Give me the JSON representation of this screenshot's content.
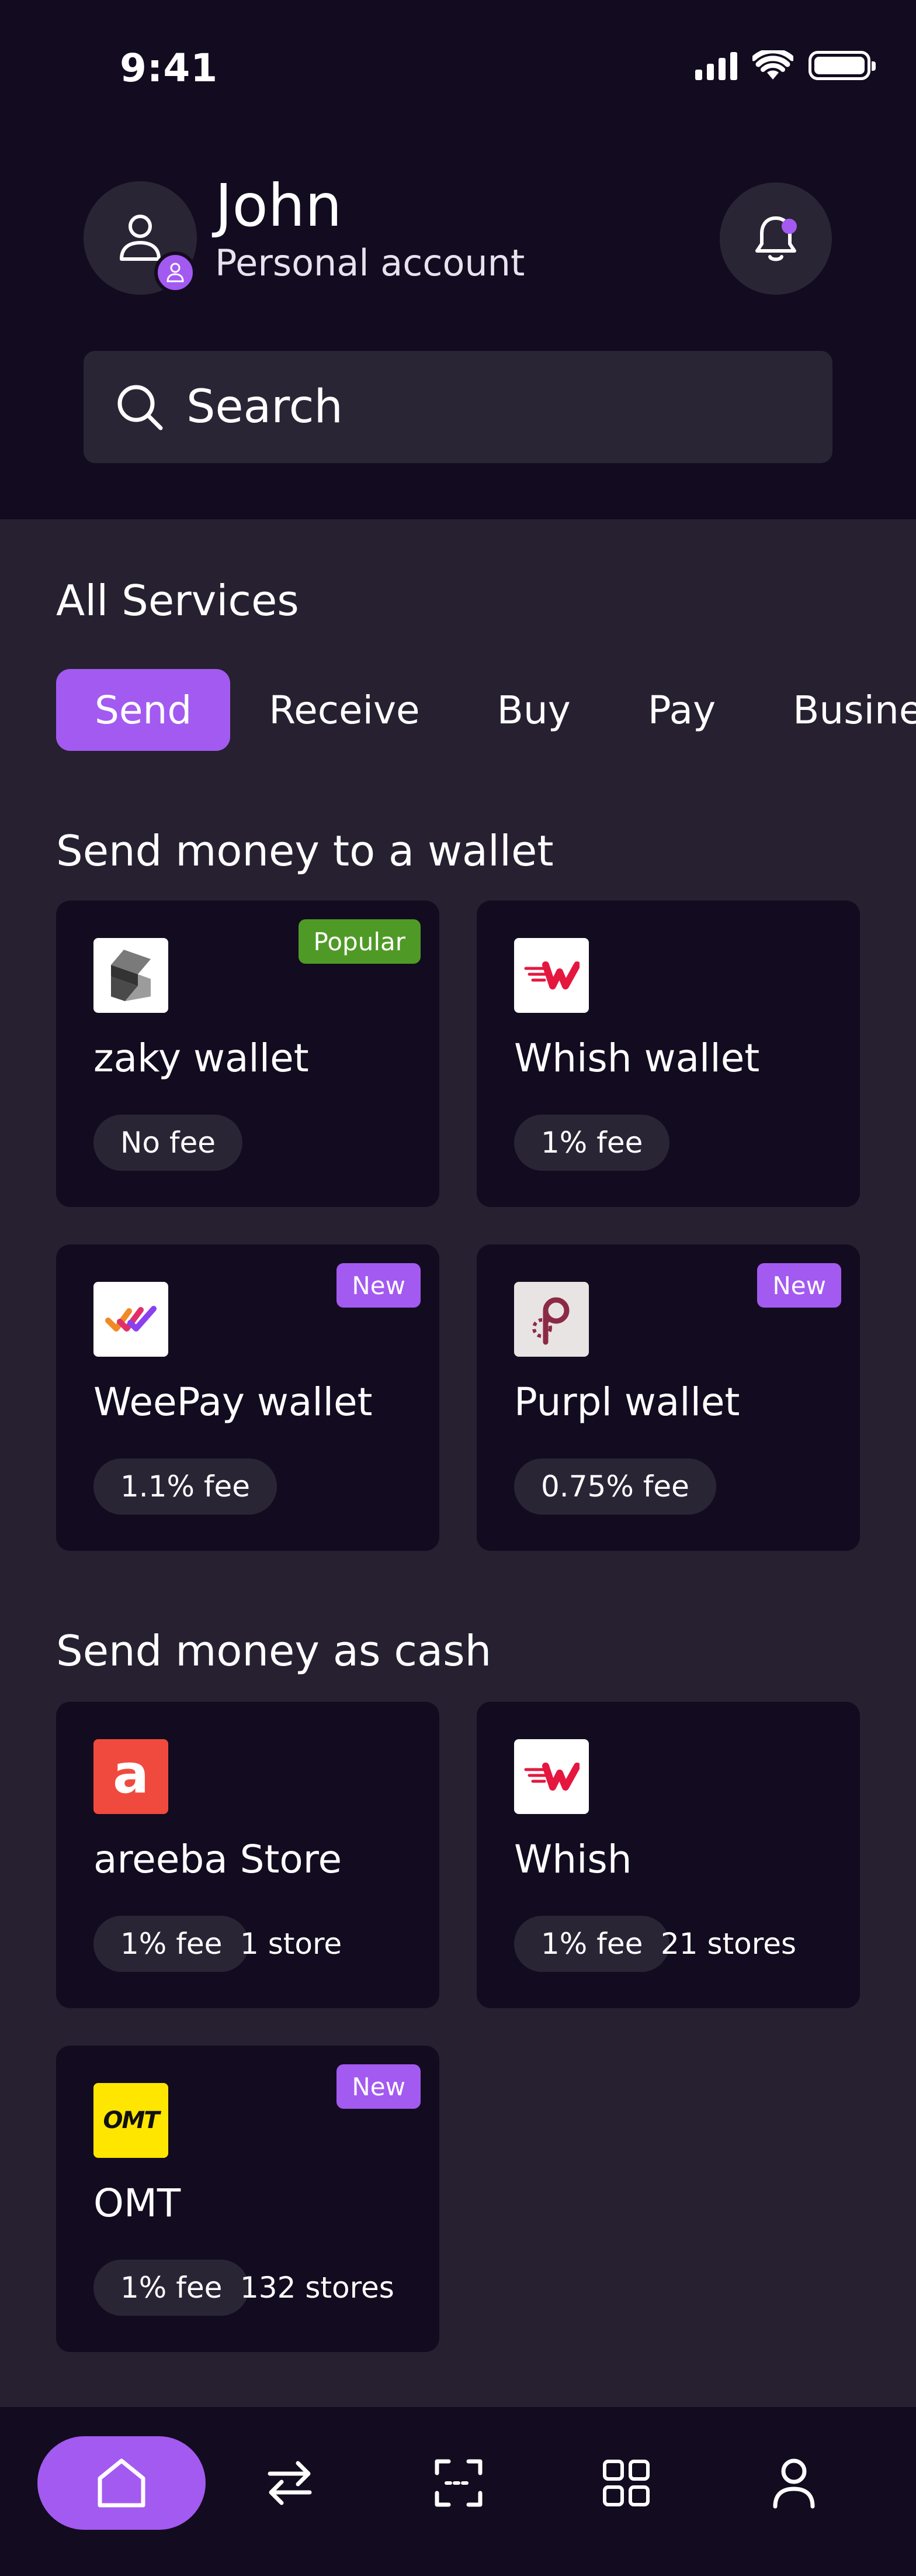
{
  "status_bar": {
    "time": "9:41"
  },
  "header": {
    "user_name": "John",
    "account_type": "Personal account"
  },
  "search": {
    "label": "Search"
  },
  "services": {
    "title": "All Services",
    "tabs": [
      {
        "label": "Send",
        "active": true
      },
      {
        "label": "Receive"
      },
      {
        "label": "Buy"
      },
      {
        "label": "Pay"
      },
      {
        "label": "Business"
      }
    ]
  },
  "wallet_section": {
    "title": "Send money to a wallet",
    "cards": [
      {
        "name": "zaky wallet",
        "fee": "No fee",
        "badge": "Popular",
        "logo_icon": "zaky-logo-icon"
      },
      {
        "name": "Whish wallet",
        "fee": "1% fee",
        "badge": "",
        "logo_icon": "whish-logo-icon"
      },
      {
        "name": "WeePay wallet",
        "fee": "1.1% fee",
        "badge": "New",
        "logo_icon": "weepay-logo-icon"
      },
      {
        "name": "Purpl wallet",
        "fee": "0.75% fee",
        "badge": "New",
        "logo_icon": "purpl-logo-icon"
      }
    ]
  },
  "cash_section": {
    "title": "Send money as cash",
    "cards": [
      {
        "name": "areeba Store",
        "fee": "1% fee",
        "stores": "1 store",
        "badge": "",
        "logo_icon": "areeba-logo-icon",
        "logo_text": "a"
      },
      {
        "name": "Whish",
        "fee": "1% fee",
        "stores": "21 stores",
        "badge": "",
        "logo_icon": "whish-logo-icon"
      },
      {
        "name": "OMT",
        "fee": "1% fee",
        "stores": "132 stores",
        "badge": "New",
        "logo_icon": "omt-logo-icon",
        "logo_text": "OMT"
      }
    ]
  },
  "bottom_nav": {
    "items": [
      {
        "icon": "home-icon",
        "active": true
      },
      {
        "icon": "transfer-icon"
      },
      {
        "icon": "scan-icon"
      },
      {
        "icon": "services-grid-icon"
      },
      {
        "icon": "profile-icon"
      }
    ]
  },
  "colors": {
    "accent": "#a35af0",
    "badge_popular": "#4f9a27",
    "badge_new": "#a35af0",
    "background_dark": "#130b1f",
    "background": "#262030",
    "areeba_red": "#f04a3e",
    "whish_red": "#e5173f",
    "omt_yellow": "#ffe600"
  }
}
